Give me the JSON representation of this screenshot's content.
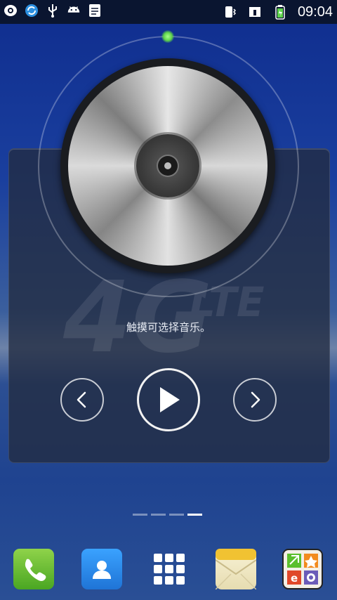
{
  "status_bar": {
    "time": "09:04",
    "left_icons": [
      "camera-icon",
      "sync-icon",
      "usb-icon",
      "android-icon",
      "notes-icon"
    ],
    "right_icons": [
      "vibrate-icon",
      "signal-icon",
      "battery-icon"
    ]
  },
  "music_widget": {
    "hint": "触摸可选择音乐。",
    "watermark": "4G LTE",
    "buttons": [
      "previous",
      "play",
      "next"
    ]
  },
  "pager": {
    "pages": 4,
    "active_index": 3
  },
  "dock": {
    "apps": [
      "phone",
      "contacts",
      "app-drawer",
      "messages",
      "app-store"
    ]
  },
  "colors": {
    "phone": "#5bbf2d",
    "contacts": "#2a8ef0",
    "accent_green": "#5ed44a"
  }
}
